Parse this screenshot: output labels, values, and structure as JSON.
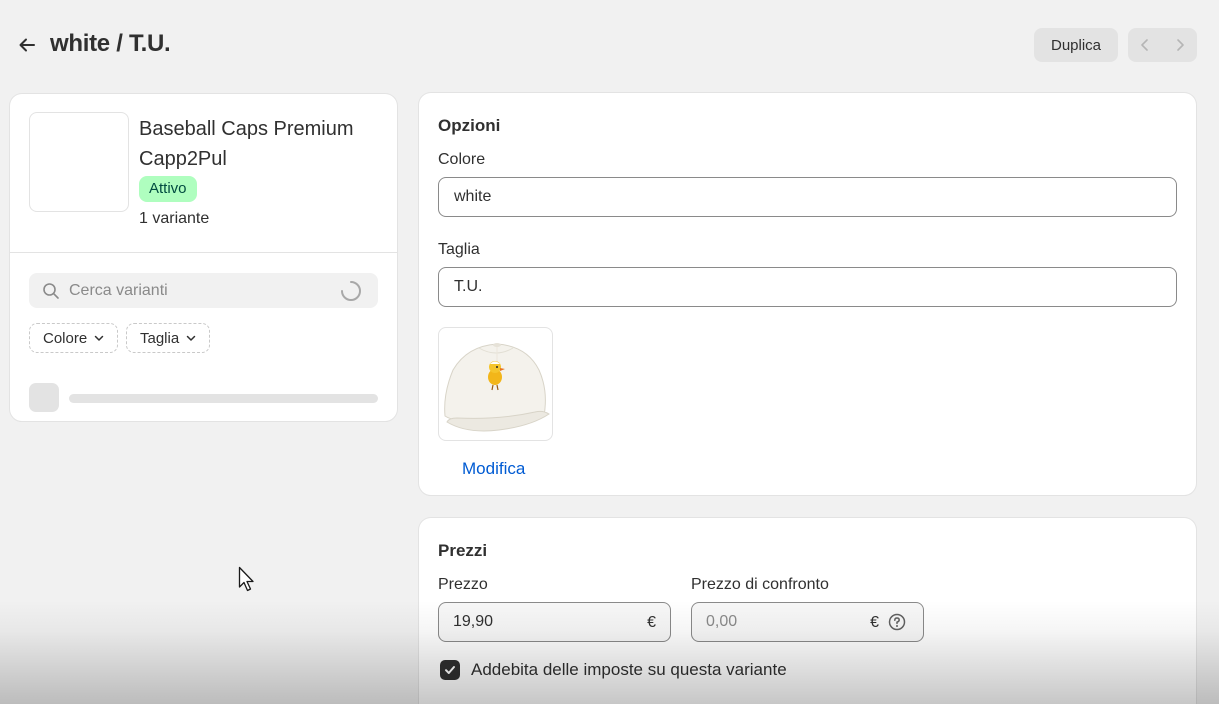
{
  "header": {
    "title": "white / T.U.",
    "duplicate_label": "Duplica"
  },
  "product": {
    "name": "Baseball Caps Premium Capp2Pul",
    "status": "Attivo",
    "variant_count": "1 variante",
    "search": {
      "placeholder": "Cerca varianti"
    },
    "filters": [
      {
        "label": "Colore"
      },
      {
        "label": "Taglia"
      }
    ]
  },
  "options": {
    "title": "Opzioni",
    "color": {
      "label": "Colore",
      "value": "white"
    },
    "size": {
      "label": "Taglia",
      "value": "T.U."
    },
    "media": {
      "edit_label": "Modifica"
    }
  },
  "prices": {
    "title": "Prezzi",
    "price": {
      "label": "Prezzo",
      "value": "19,90",
      "currency": "€"
    },
    "compare_price": {
      "label": "Prezzo di confronto",
      "placeholder": "0,00",
      "currency": "€"
    },
    "tax_checkbox": {
      "label": "Addebita delle imposte su questa variante",
      "checked": true
    }
  },
  "colors": {
    "accent_link": "#005bd3",
    "status_bg": "#affebf",
    "status_text": "#014b40"
  }
}
